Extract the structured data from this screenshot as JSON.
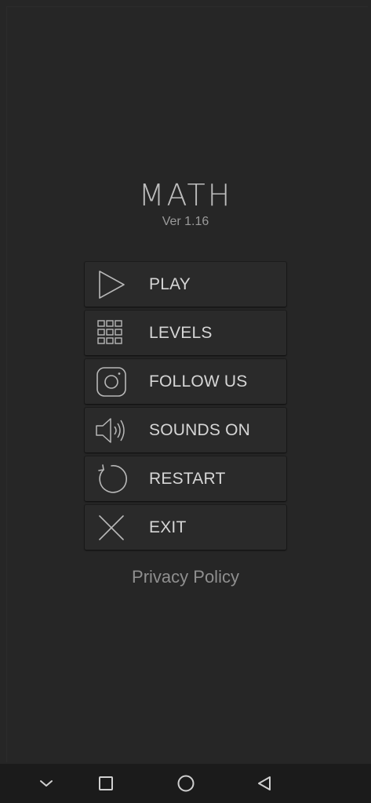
{
  "app": {
    "title": "MATH",
    "version": "Ver 1.16"
  },
  "menu": [
    {
      "label": "PLAY",
      "icon": "play-icon"
    },
    {
      "label": "LEVELS",
      "icon": "grid-icon"
    },
    {
      "label": "FOLLOW US",
      "icon": "instagram-icon"
    },
    {
      "label": "SOUNDS ON",
      "icon": "speaker-icon"
    },
    {
      "label": "RESTART",
      "icon": "restart-icon"
    },
    {
      "label": "EXIT",
      "icon": "close-icon"
    }
  ],
  "privacy_label": "Privacy Policy",
  "navbar": {
    "icons": [
      "chevron-down-icon",
      "recents-square-icon",
      "home-circle-icon",
      "back-triangle-icon"
    ]
  },
  "colors": {
    "background": "#262626",
    "button": "#2a2a2a",
    "text": "#d6d6d6",
    "muted": "#8f8f8f",
    "navbar": "#1b1b1b"
  }
}
